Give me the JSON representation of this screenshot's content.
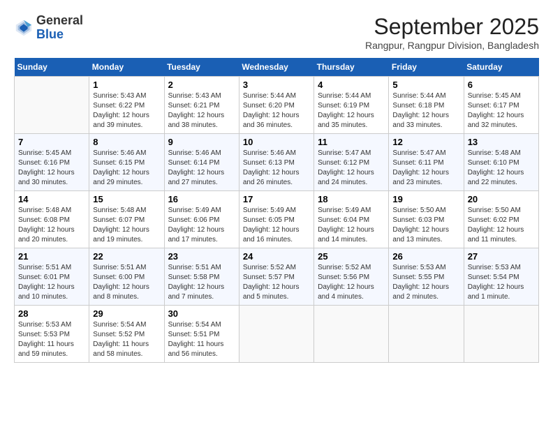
{
  "header": {
    "logo": {
      "line1": "General",
      "line2": "Blue"
    },
    "title": "September 2025",
    "location": "Rangpur, Rangpur Division, Bangladesh"
  },
  "calendar": {
    "weekdays": [
      "Sunday",
      "Monday",
      "Tuesday",
      "Wednesday",
      "Thursday",
      "Friday",
      "Saturday"
    ],
    "weeks": [
      [
        {
          "day": "",
          "info": ""
        },
        {
          "day": "1",
          "info": "Sunrise: 5:43 AM\nSunset: 6:22 PM\nDaylight: 12 hours\nand 39 minutes."
        },
        {
          "day": "2",
          "info": "Sunrise: 5:43 AM\nSunset: 6:21 PM\nDaylight: 12 hours\nand 38 minutes."
        },
        {
          "day": "3",
          "info": "Sunrise: 5:44 AM\nSunset: 6:20 PM\nDaylight: 12 hours\nand 36 minutes."
        },
        {
          "day": "4",
          "info": "Sunrise: 5:44 AM\nSunset: 6:19 PM\nDaylight: 12 hours\nand 35 minutes."
        },
        {
          "day": "5",
          "info": "Sunrise: 5:44 AM\nSunset: 6:18 PM\nDaylight: 12 hours\nand 33 minutes."
        },
        {
          "day": "6",
          "info": "Sunrise: 5:45 AM\nSunset: 6:17 PM\nDaylight: 12 hours\nand 32 minutes."
        }
      ],
      [
        {
          "day": "7",
          "info": "Sunrise: 5:45 AM\nSunset: 6:16 PM\nDaylight: 12 hours\nand 30 minutes."
        },
        {
          "day": "8",
          "info": "Sunrise: 5:46 AM\nSunset: 6:15 PM\nDaylight: 12 hours\nand 29 minutes."
        },
        {
          "day": "9",
          "info": "Sunrise: 5:46 AM\nSunset: 6:14 PM\nDaylight: 12 hours\nand 27 minutes."
        },
        {
          "day": "10",
          "info": "Sunrise: 5:46 AM\nSunset: 6:13 PM\nDaylight: 12 hours\nand 26 minutes."
        },
        {
          "day": "11",
          "info": "Sunrise: 5:47 AM\nSunset: 6:12 PM\nDaylight: 12 hours\nand 24 minutes."
        },
        {
          "day": "12",
          "info": "Sunrise: 5:47 AM\nSunset: 6:11 PM\nDaylight: 12 hours\nand 23 minutes."
        },
        {
          "day": "13",
          "info": "Sunrise: 5:48 AM\nSunset: 6:10 PM\nDaylight: 12 hours\nand 22 minutes."
        }
      ],
      [
        {
          "day": "14",
          "info": "Sunrise: 5:48 AM\nSunset: 6:08 PM\nDaylight: 12 hours\nand 20 minutes."
        },
        {
          "day": "15",
          "info": "Sunrise: 5:48 AM\nSunset: 6:07 PM\nDaylight: 12 hours\nand 19 minutes."
        },
        {
          "day": "16",
          "info": "Sunrise: 5:49 AM\nSunset: 6:06 PM\nDaylight: 12 hours\nand 17 minutes."
        },
        {
          "day": "17",
          "info": "Sunrise: 5:49 AM\nSunset: 6:05 PM\nDaylight: 12 hours\nand 16 minutes."
        },
        {
          "day": "18",
          "info": "Sunrise: 5:49 AM\nSunset: 6:04 PM\nDaylight: 12 hours\nand 14 minutes."
        },
        {
          "day": "19",
          "info": "Sunrise: 5:50 AM\nSunset: 6:03 PM\nDaylight: 12 hours\nand 13 minutes."
        },
        {
          "day": "20",
          "info": "Sunrise: 5:50 AM\nSunset: 6:02 PM\nDaylight: 12 hours\nand 11 minutes."
        }
      ],
      [
        {
          "day": "21",
          "info": "Sunrise: 5:51 AM\nSunset: 6:01 PM\nDaylight: 12 hours\nand 10 minutes."
        },
        {
          "day": "22",
          "info": "Sunrise: 5:51 AM\nSunset: 6:00 PM\nDaylight: 12 hours\nand 8 minutes."
        },
        {
          "day": "23",
          "info": "Sunrise: 5:51 AM\nSunset: 5:58 PM\nDaylight: 12 hours\nand 7 minutes."
        },
        {
          "day": "24",
          "info": "Sunrise: 5:52 AM\nSunset: 5:57 PM\nDaylight: 12 hours\nand 5 minutes."
        },
        {
          "day": "25",
          "info": "Sunrise: 5:52 AM\nSunset: 5:56 PM\nDaylight: 12 hours\nand 4 minutes."
        },
        {
          "day": "26",
          "info": "Sunrise: 5:53 AM\nSunset: 5:55 PM\nDaylight: 12 hours\nand 2 minutes."
        },
        {
          "day": "27",
          "info": "Sunrise: 5:53 AM\nSunset: 5:54 PM\nDaylight: 12 hours\nand 1 minute."
        }
      ],
      [
        {
          "day": "28",
          "info": "Sunrise: 5:53 AM\nSunset: 5:53 PM\nDaylight: 11 hours\nand 59 minutes."
        },
        {
          "day": "29",
          "info": "Sunrise: 5:54 AM\nSunset: 5:52 PM\nDaylight: 11 hours\nand 58 minutes."
        },
        {
          "day": "30",
          "info": "Sunrise: 5:54 AM\nSunset: 5:51 PM\nDaylight: 11 hours\nand 56 minutes."
        },
        {
          "day": "",
          "info": ""
        },
        {
          "day": "",
          "info": ""
        },
        {
          "day": "",
          "info": ""
        },
        {
          "day": "",
          "info": ""
        }
      ]
    ]
  }
}
